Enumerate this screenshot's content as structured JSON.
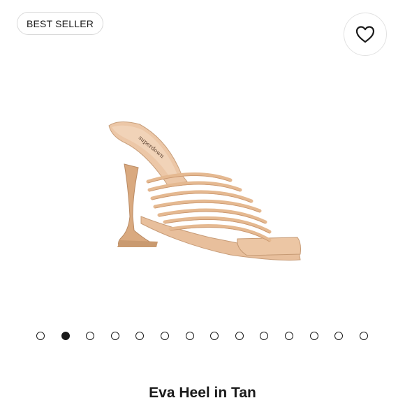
{
  "badge": {
    "label": "BEST SELLER"
  },
  "favorite": {
    "icon": "heart-icon"
  },
  "product": {
    "title": "Eva Heel in Tan",
    "image": {
      "brand_imprint": "superdown"
    },
    "color_hex": "#e9c3a3"
  },
  "carousel": {
    "total_slides": 14,
    "active_index": 1
  }
}
